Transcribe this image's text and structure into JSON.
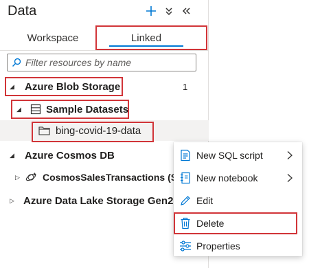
{
  "panel": {
    "title": "Data"
  },
  "header_icons": [
    "plus-icon",
    "double-chevron-down-icon",
    "double-chevron-left-icon"
  ],
  "tabs": [
    {
      "label": "Workspace",
      "active": false
    },
    {
      "label": "Linked",
      "active": true
    }
  ],
  "search": {
    "placeholder": "Filter resources by name",
    "value": ""
  },
  "tree": {
    "blob_storage": {
      "label": "Azure Blob Storage",
      "count": "1"
    },
    "sample_datasets": {
      "label": "Sample Datasets"
    },
    "dataset_folder": {
      "label": "bing-covid-19-data"
    },
    "cosmos_db": {
      "label": "Azure Cosmos DB"
    },
    "cosmos_collection": {
      "label": "CosmosSalesTransactions (Sales"
    },
    "data_lake": {
      "label": "Azure Data Lake Storage Gen2"
    }
  },
  "context_menu": {
    "items": [
      {
        "label": "New SQL script",
        "icon": "sql-script-icon",
        "has_submenu": true
      },
      {
        "label": "New notebook",
        "icon": "notebook-icon",
        "has_submenu": true
      },
      {
        "label": "Edit",
        "icon": "pencil-icon",
        "has_submenu": false
      },
      {
        "label": "Delete",
        "icon": "trash-icon",
        "has_submenu": false
      },
      {
        "label": "Properties",
        "icon": "sliders-icon",
        "has_submenu": false
      }
    ]
  },
  "colors": {
    "accent": "#0078d4",
    "highlight_box": "#d13438",
    "selected_row": "#f3f2f1"
  }
}
